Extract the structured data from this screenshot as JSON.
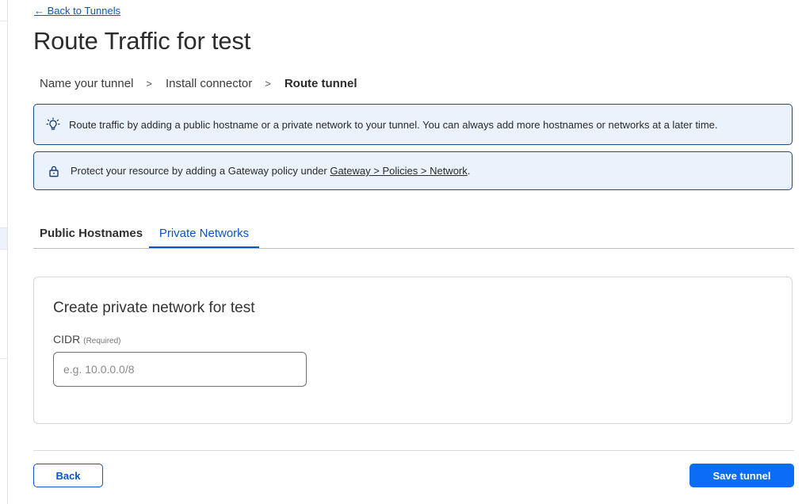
{
  "nav": {
    "back_link": "← Back to Tunnels"
  },
  "page": {
    "title": "Route Traffic for test"
  },
  "breadcrumb": {
    "steps": [
      "Name your tunnel",
      "Install connector",
      "Route tunnel"
    ],
    "separator": ">"
  },
  "banners": {
    "tip": {
      "icon": "lightbulb-icon",
      "text": "Route traffic by adding a public hostname or a private network to your tunnel. You can always add more hostnames or networks at a later time."
    },
    "policy": {
      "icon": "lock-icon",
      "text_before": "Protect your resource by adding a Gateway policy under ",
      "link": "Gateway > Policies > Network",
      "text_after": "."
    }
  },
  "tabs": [
    {
      "label": "Public Hostnames",
      "active": false
    },
    {
      "label": "Private Networks",
      "active": true
    }
  ],
  "form": {
    "title": "Create private network for test",
    "cidr_label": "CIDR",
    "cidr_required": "(Required)",
    "cidr_value": "",
    "cidr_placeholder": "e.g. 10.0.0.0/8"
  },
  "footer": {
    "back_button": "Back",
    "save_button": "Save tunnel"
  },
  "colors": {
    "accent": "#0b55c8",
    "primary_button": "#0b6cf5",
    "banner_bg": "#eaf2fc",
    "banner_border": "#224a7c"
  }
}
